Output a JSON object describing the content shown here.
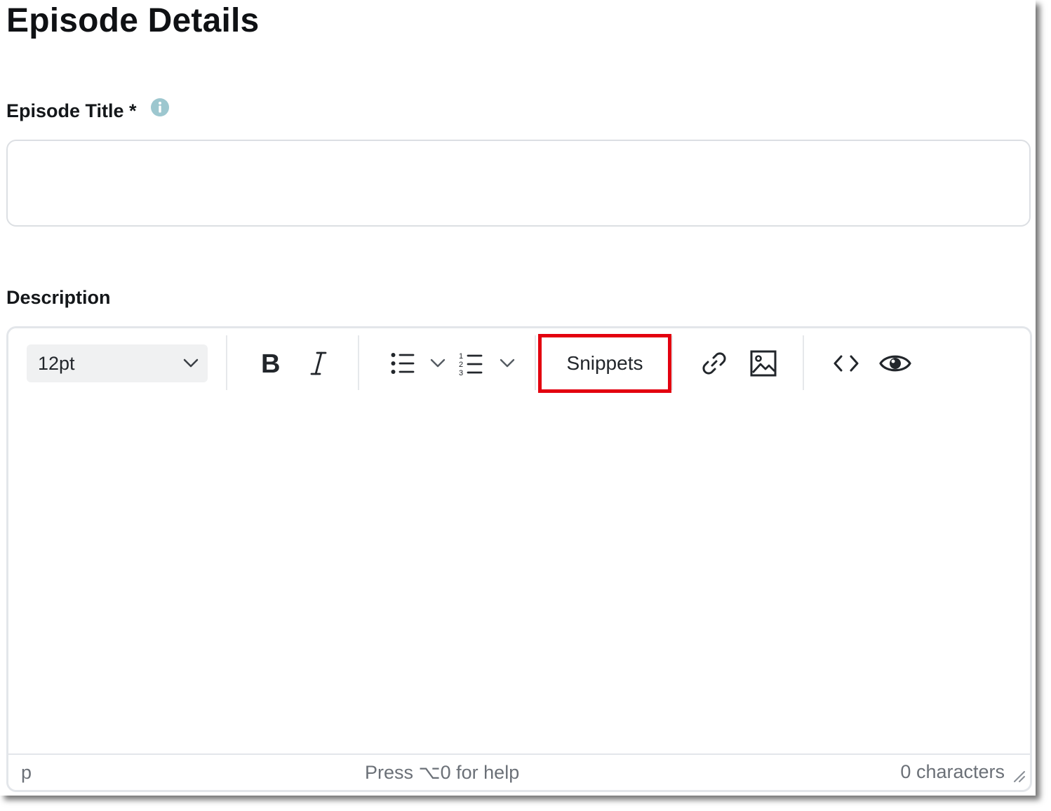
{
  "page": {
    "title": "Episode Details"
  },
  "episode_title": {
    "label": "Episode Title *",
    "info_icon": "info-circle-icon",
    "value": "",
    "placeholder": ""
  },
  "description": {
    "label": "Description",
    "toolbar": {
      "font_size": "12pt",
      "bold_icon": "bold-icon",
      "italic_icon": "italic-icon",
      "bullet_list_icon": "bullet-list-icon",
      "numbered_list_icon": "numbered-list-icon",
      "snippets_label": "Snippets",
      "link_icon": "link-icon",
      "image_icon": "image-icon",
      "code_icon": "code-icon",
      "preview_icon": "eye-icon"
    },
    "status": {
      "path": "p",
      "help": "Press ⌥0 for help",
      "count": "0 characters"
    }
  },
  "colors": {
    "highlight": "#e3000f",
    "info_icon": "#9dc7cf",
    "text_primary": "#0f1114",
    "text_muted": "#6b7077"
  }
}
